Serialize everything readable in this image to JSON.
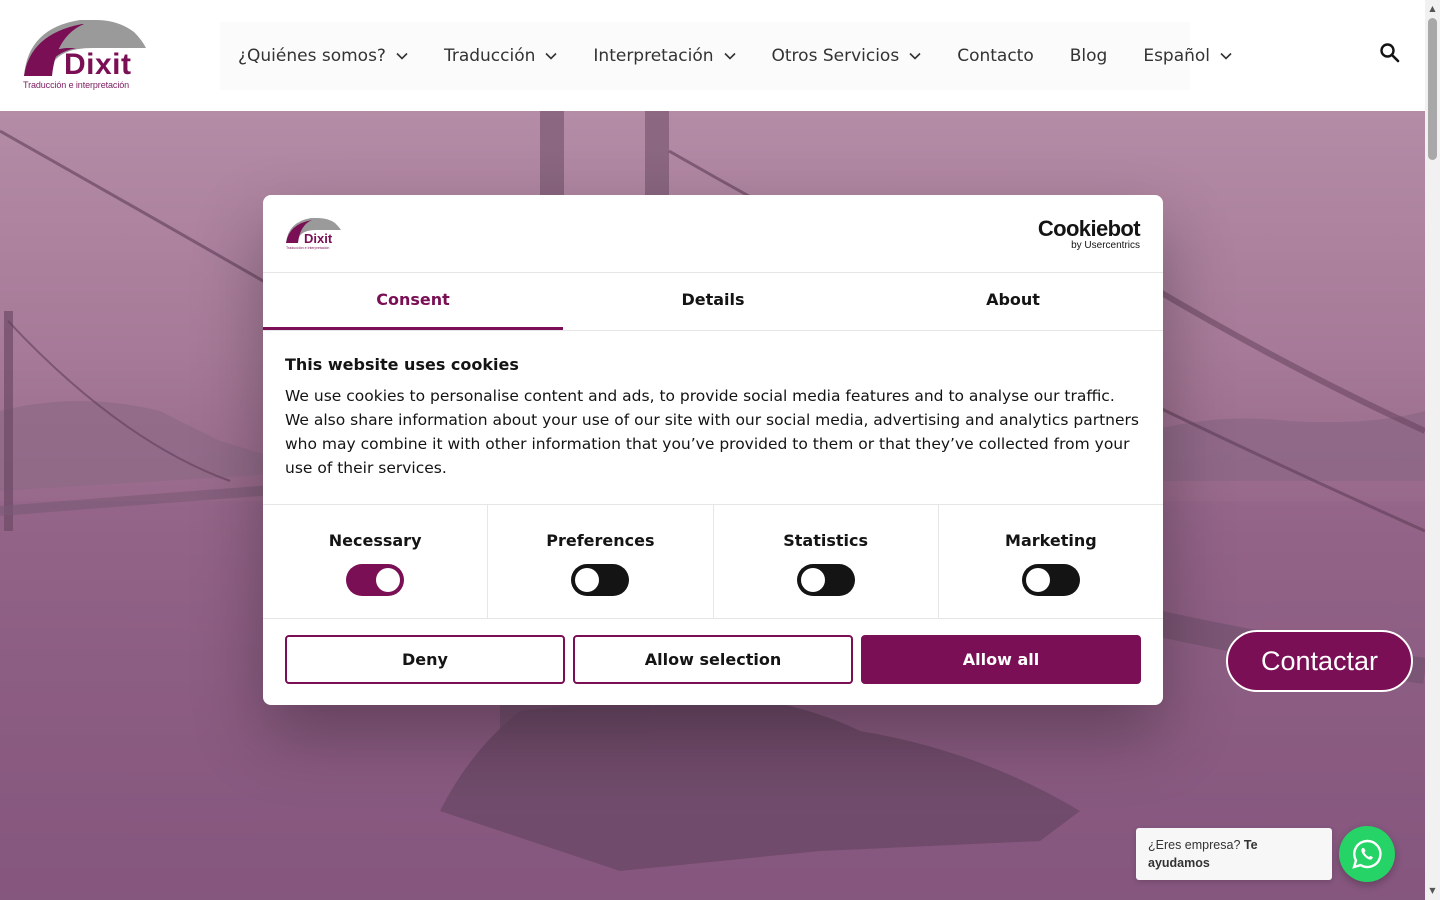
{
  "header": {
    "logo_text": "Dixit",
    "logo_subtitle": "Traducción e interpretación",
    "nav": [
      {
        "label": "¿Quiénes somos?",
        "has_dropdown": true
      },
      {
        "label": "Traducción",
        "has_dropdown": true
      },
      {
        "label": "Interpretación",
        "has_dropdown": true
      },
      {
        "label": "Otros Servicios",
        "has_dropdown": true
      },
      {
        "label": "Contacto",
        "has_dropdown": false
      },
      {
        "label": "Blog",
        "has_dropdown": false
      },
      {
        "label": "Español",
        "has_dropdown": true
      }
    ],
    "search_icon": "search-icon"
  },
  "cookie_dialog": {
    "brand_title": "Cookiebot",
    "brand_by": "by Usercentrics",
    "tabs": [
      {
        "label": "Consent",
        "active": true
      },
      {
        "label": "Details",
        "active": false
      },
      {
        "label": "About",
        "active": false
      }
    ],
    "heading": "This website uses cookies",
    "body": "We use cookies to personalise content and ads, to provide social media features and to analyse our traffic. We also share information about your use of our site with our social media, advertising and analytics partners who may combine it with other information that you’ve provided to them or that they’ve collected from your use of their services.",
    "toggles": [
      {
        "label": "Necessary",
        "on": true
      },
      {
        "label": "Preferences",
        "on": false
      },
      {
        "label": "Statistics",
        "on": false
      },
      {
        "label": "Marketing",
        "on": false
      }
    ],
    "buttons": {
      "deny": "Deny",
      "allow_selection": "Allow selection",
      "allow_all": "Allow all"
    }
  },
  "contactar_label": "Contactar",
  "whatsapp": {
    "text": "¿Eres empresa?",
    "bold_text": "Te ayudamos",
    "icon": "whatsapp-icon"
  },
  "colors": {
    "brand": "#7a0f55",
    "whatsapp": "#25d366"
  }
}
